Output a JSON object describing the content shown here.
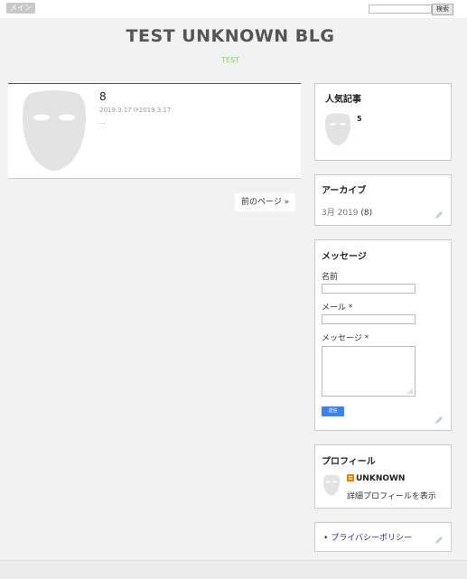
{
  "topbar": {
    "menu_label": "メイン",
    "search_button": "検索",
    "search_value": ""
  },
  "header": {
    "title": "TEST UNKNOWN BLG",
    "description": "TEST"
  },
  "post": {
    "title": "8",
    "date": "2019.3.17",
    "updated": "2019.3.17",
    "excerpt": "..."
  },
  "pager": {
    "older": "前のページ »"
  },
  "popular": {
    "title": "人気記事",
    "item_title": "5"
  },
  "archive": {
    "title": "アーカイブ",
    "month": "3月 2019",
    "count": "(8)"
  },
  "contact": {
    "title": "メッセージ",
    "name_label": "名前",
    "email_label": "メール",
    "message_label": "メッセージ",
    "required_mark": "*",
    "send_label": "送信"
  },
  "profile": {
    "title": "プロフィール",
    "name": "UNKNOWN",
    "view_profile": "詳細プロフィールを表示"
  },
  "pages": {
    "items": [
      "プライバシーポリシー"
    ]
  },
  "colors": {
    "accent_blue": "#3b82f6",
    "tagline_green": "#7ddc4a",
    "blogger_orange": "#f57d00"
  }
}
